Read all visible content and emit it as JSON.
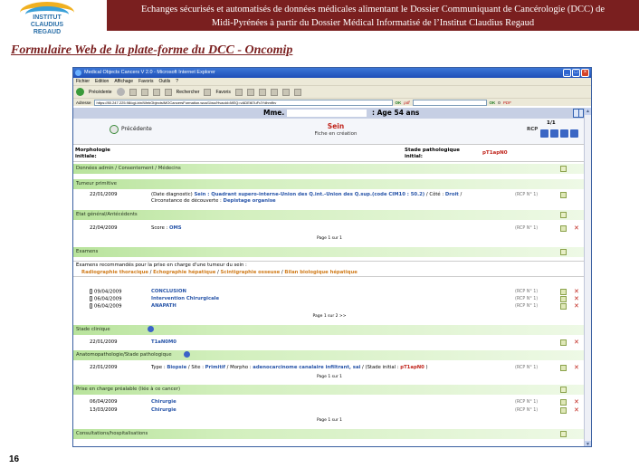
{
  "slide": {
    "logo_text": [
      "INSTITUT",
      "CLAUDIUS",
      "REGAUD"
    ],
    "banner_line1": "Echanges sécurisés et automatisés de données médicales alimentant le Dossier Communiquant de Cancérologie (DCC) de",
    "banner_line2": "Midi-Pyrénées à partir du Dossier Médical Informatisé de l’Institut Claudius Regaud",
    "title": "Formulaire Web de la plate-forme du DCC - Oncomip",
    "page_number": "16"
  },
  "browser": {
    "window_title": "Medical Objects Cancers V 2.0 - Microsoft Internet Explorer",
    "menu": [
      "Fichier",
      "Edition",
      "Affichage",
      "Favoris",
      "Outils",
      "?"
    ],
    "toolbar": {
      "back": "Précédente",
      "search": "Rechercher",
      "favorites": "Favoris"
    },
    "address_label": "Adresse",
    "address_url": "https://80.247.225.98/cgi-bin/WebObjects/MOCancersFormation.woa/1/wo/Hvaoid=MEQ=vADEt67uFrJYdhmfhv",
    "go_label": "OK",
    "pdf_label": "pdf",
    "go_label2": "OK",
    "count_label": "0",
    "pdf_label2": "PDF"
  },
  "patient": {
    "prefix": "Mme.",
    "age": ": Age 54 ans"
  },
  "nav": {
    "prev": "Précédente",
    "organ": "Sein",
    "status": "Fiche en création",
    "rcp": "RCP",
    "pager": "1/1"
  },
  "morpho": {
    "label_line1": "Morphologie",
    "label_line2": "initiale:",
    "stade_line1": "Stade pathologique",
    "stade_line2": "initial:",
    "stade_value": "pT1apN0"
  },
  "sections": {
    "admin": "Données admin / Consentement / Médecins",
    "tumeur": "Tumeur primitive",
    "etat": "Etat général/Antécédents",
    "examens": "Examens",
    "stade_clinique": "Stade clinique",
    "anapath": "Anatomopathologie/Stade pathologique",
    "prise": "Prise en charge préalable (liée à ce cancer)",
    "consult": "Consultations/hospitalisations"
  },
  "tumeur": {
    "date": "22/01/2009",
    "p1": "(Date diagnostic)",
    "v1": "Sein : Quadrant supero-interne-Union des Q.int.-Union des Q.sup.(code CIM10 : 50.2)",
    "p2": "/ Côté :",
    "v2": "Droit",
    "p3": "/",
    "p4": "Circonstance de découverte :",
    "v4": "Depistage organise",
    "rcp": "(RCP N° 1)"
  },
  "etat": {
    "date": "22/04/2009",
    "p1": "Score :",
    "v1": "OMS",
    "rcp": "(RCP N° 1)",
    "page": "Page 1 sur 1"
  },
  "reco": {
    "head": "Examens recommandés pour la prise en charge d'une tumeur du sein :",
    "i1": "Radiographie thoracique",
    "i2": "Echographie hépatique",
    "i3": "Scintigraphie osseuse",
    "i4": "Bilan biologique hépatique",
    "sep": "/"
  },
  "examens": [
    {
      "date": "09/04/2009",
      "label": "CONCLUSION",
      "rcp": "(RCP N° 1)"
    },
    {
      "date": "06/04/2009",
      "label": "Intervention Chirurgicale",
      "rcp": "(RCP N° 1)"
    },
    {
      "date": "06/04/2009",
      "label": "ANAPATH",
      "rcp": "(RCP N° 1)"
    }
  ],
  "examens_page": "Page 1 sur 2  >>",
  "stade_clinique": {
    "date": "22/01/2009",
    "value": "T1aN0M0"
  },
  "anapath": {
    "date": "22/01/2009",
    "p1": "Type :",
    "v1": "Biopsie",
    "p2": "/ Site :",
    "v2": "Primitif",
    "p3": "/ Morpho :",
    "v3": "adenocarcinome canalaire infiltrant, sai",
    "p4": "/ (Stade initial :",
    "v4": "pT1apN0",
    "p5": ")",
    "rcp": "(RCP N° 1)",
    "page": "Page 1 sur 1"
  },
  "prise": [
    {
      "date": "06/04/2009",
      "label": "Chirurgie",
      "rcp": "(RCP N° 1)"
    },
    {
      "date": "13/03/2009",
      "label": "Chirurgie",
      "rcp": "(RCP N° 1)"
    }
  ],
  "prise_page": "Page 1 sur 1",
  "colors": {
    "banner": "#7a1f1f",
    "section_green": "#b8e39c",
    "link_blue": "#2754a8",
    "alert_red": "#c0241b",
    "orange": "#d07b1a"
  }
}
